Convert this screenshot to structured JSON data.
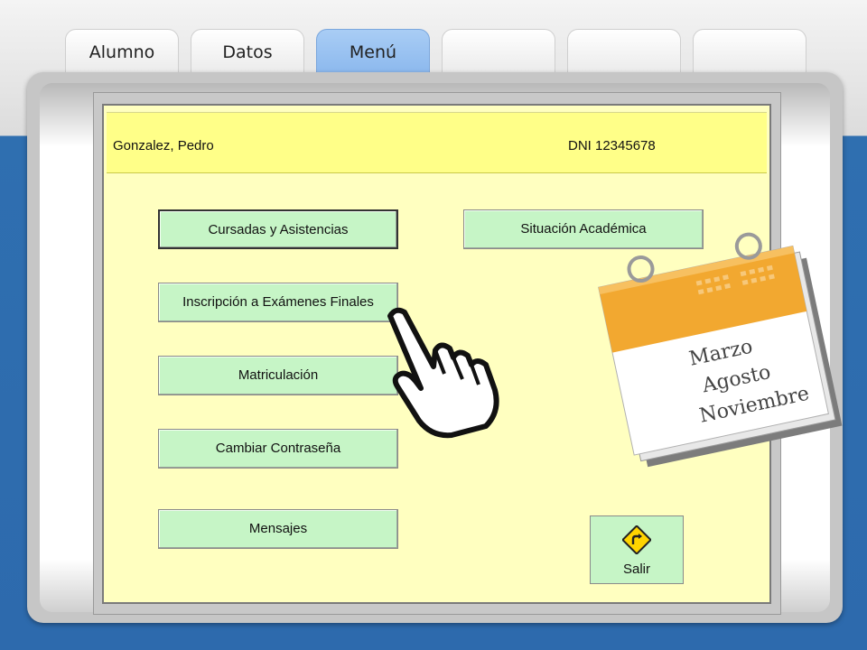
{
  "tabs": [
    {
      "label": "Alumno",
      "active": false
    },
    {
      "label": "Datos",
      "active": false
    },
    {
      "label": "Menú",
      "active": true
    },
    {
      "label": "",
      "active": false
    },
    {
      "label": "",
      "active": false
    },
    {
      "label": "",
      "active": false
    }
  ],
  "student": {
    "name": "Gonzalez, Pedro",
    "dni": "DNI  12345678"
  },
  "menu": {
    "cursadas": "Cursadas y Asistencias",
    "inscripcion": "Inscripción a Exámenes Finales",
    "matriculacion": "Matriculación",
    "cambiar_contrasena": "Cambiar Contraseña",
    "mensajes": "Mensajes",
    "situacion": "Situación Académica",
    "salir": "Salir"
  },
  "calendar": {
    "months": [
      "Marzo",
      "Agosto",
      "Noviembre"
    ]
  },
  "icons": {
    "exit": "road-sign-turn-right-icon",
    "hand": "pointing-hand-icon",
    "calendar": "calendar-icon"
  },
  "colors": {
    "header": "#ffff88",
    "window_bg": "#ffffc0",
    "button": "#c6f5c6",
    "active_tab": "#86b4ec",
    "page_blue": "#2d6aad"
  }
}
